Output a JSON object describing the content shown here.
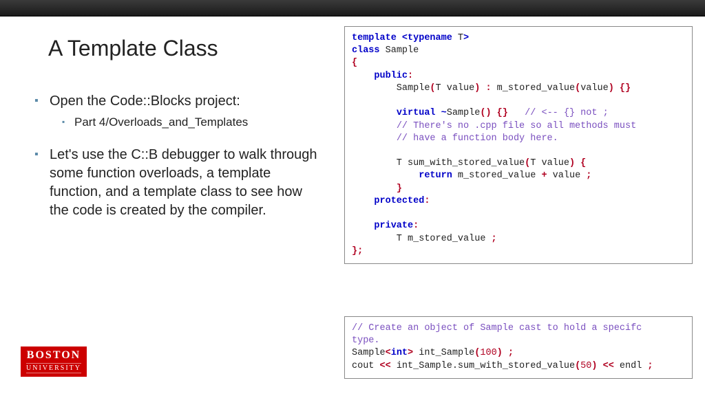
{
  "title": "A Template Class",
  "bullets": [
    {
      "text": "Open the Code::Blocks project:",
      "sub": [
        "Part 4/Overloads_and_Templates"
      ]
    },
    {
      "text": "Let's use the C::B debugger to walk through some function overloads, a template function, and a template class to see how the code is created by the compiler."
    }
  ],
  "logo": {
    "line1": "BOSTON",
    "line2": "UNIVERSITY"
  },
  "code1": [
    {
      "t": [
        {
          "c": "kw",
          "s": "template <typename"
        },
        {
          "s": " T"
        },
        {
          "c": "kw",
          "s": ">"
        }
      ]
    },
    {
      "t": [
        {
          "c": "kw",
          "s": "class"
        },
        {
          "s": " Sample"
        }
      ]
    },
    {
      "t": [
        {
          "c": "pn",
          "s": "{"
        }
      ]
    },
    {
      "t": [
        {
          "s": "    "
        },
        {
          "c": "kw",
          "s": "public"
        },
        {
          "c": "pn",
          "s": ":"
        }
      ]
    },
    {
      "t": [
        {
          "s": "        Sample"
        },
        {
          "c": "pn",
          "s": "("
        },
        {
          "s": "T value"
        },
        {
          "c": "pn",
          "s": ") :"
        },
        {
          "s": " m_stored_value"
        },
        {
          "c": "pn",
          "s": "("
        },
        {
          "s": "value"
        },
        {
          "c": "pn",
          "s": ") {}"
        }
      ]
    },
    {
      "t": [
        {
          "s": ""
        }
      ]
    },
    {
      "t": [
        {
          "s": "        "
        },
        {
          "c": "kw",
          "s": "virtual ~"
        },
        {
          "s": "Sample"
        },
        {
          "c": "pn",
          "s": "() {}"
        },
        {
          "s": "   "
        },
        {
          "c": "cm",
          "s": "// <-- {} not ;"
        }
      ]
    },
    {
      "t": [
        {
          "s": "        "
        },
        {
          "c": "cm",
          "s": "// There's no .cpp file so all methods must"
        }
      ]
    },
    {
      "t": [
        {
          "s": "        "
        },
        {
          "c": "cm",
          "s": "// have a function body here."
        }
      ]
    },
    {
      "t": [
        {
          "s": ""
        }
      ]
    },
    {
      "t": [
        {
          "s": "        T sum_with_stored_value"
        },
        {
          "c": "pn",
          "s": "("
        },
        {
          "s": "T value"
        },
        {
          "c": "pn",
          "s": ") {"
        }
      ]
    },
    {
      "t": [
        {
          "s": "            "
        },
        {
          "c": "kw",
          "s": "return"
        },
        {
          "s": " m_stored_value "
        },
        {
          "c": "pn",
          "s": "+"
        },
        {
          "s": " value "
        },
        {
          "c": "pn",
          "s": ";"
        }
      ]
    },
    {
      "t": [
        {
          "s": "        "
        },
        {
          "c": "pn",
          "s": "}"
        }
      ]
    },
    {
      "t": [
        {
          "s": "    "
        },
        {
          "c": "kw",
          "s": "protected"
        },
        {
          "c": "pn",
          "s": ":"
        }
      ]
    },
    {
      "t": [
        {
          "s": ""
        }
      ]
    },
    {
      "t": [
        {
          "s": "    "
        },
        {
          "c": "kw",
          "s": "private"
        },
        {
          "c": "pn",
          "s": ":"
        }
      ]
    },
    {
      "t": [
        {
          "s": "        T m_stored_value "
        },
        {
          "c": "pn",
          "s": ";"
        }
      ]
    },
    {
      "t": [
        {
          "c": "pn",
          "s": "};"
        }
      ]
    }
  ],
  "code2": [
    {
      "t": [
        {
          "c": "cm",
          "s": "// Create an object of Sample cast to hold a specifc"
        }
      ]
    },
    {
      "t": [
        {
          "c": "cm",
          "s": "type."
        }
      ]
    },
    {
      "t": [
        {
          "s": "Sample"
        },
        {
          "c": "pn",
          "s": "<"
        },
        {
          "c": "kw",
          "s": "int"
        },
        {
          "c": "pn",
          "s": ">"
        },
        {
          "s": " int_Sample"
        },
        {
          "c": "pn",
          "s": "("
        },
        {
          "c": "nm",
          "s": "100"
        },
        {
          "c": "pn",
          "s": ")"
        },
        {
          "s": " "
        },
        {
          "c": "pn",
          "s": ";"
        }
      ]
    },
    {
      "t": [
        {
          "s": "cout "
        },
        {
          "c": "pn",
          "s": "<<"
        },
        {
          "s": " int_Sample.sum_with_stored_value"
        },
        {
          "c": "pn",
          "s": "("
        },
        {
          "c": "nm",
          "s": "50"
        },
        {
          "c": "pn",
          "s": ")"
        },
        {
          "s": " "
        },
        {
          "c": "pn",
          "s": "<<"
        },
        {
          "s": " endl "
        },
        {
          "c": "pn",
          "s": ";"
        }
      ]
    }
  ]
}
